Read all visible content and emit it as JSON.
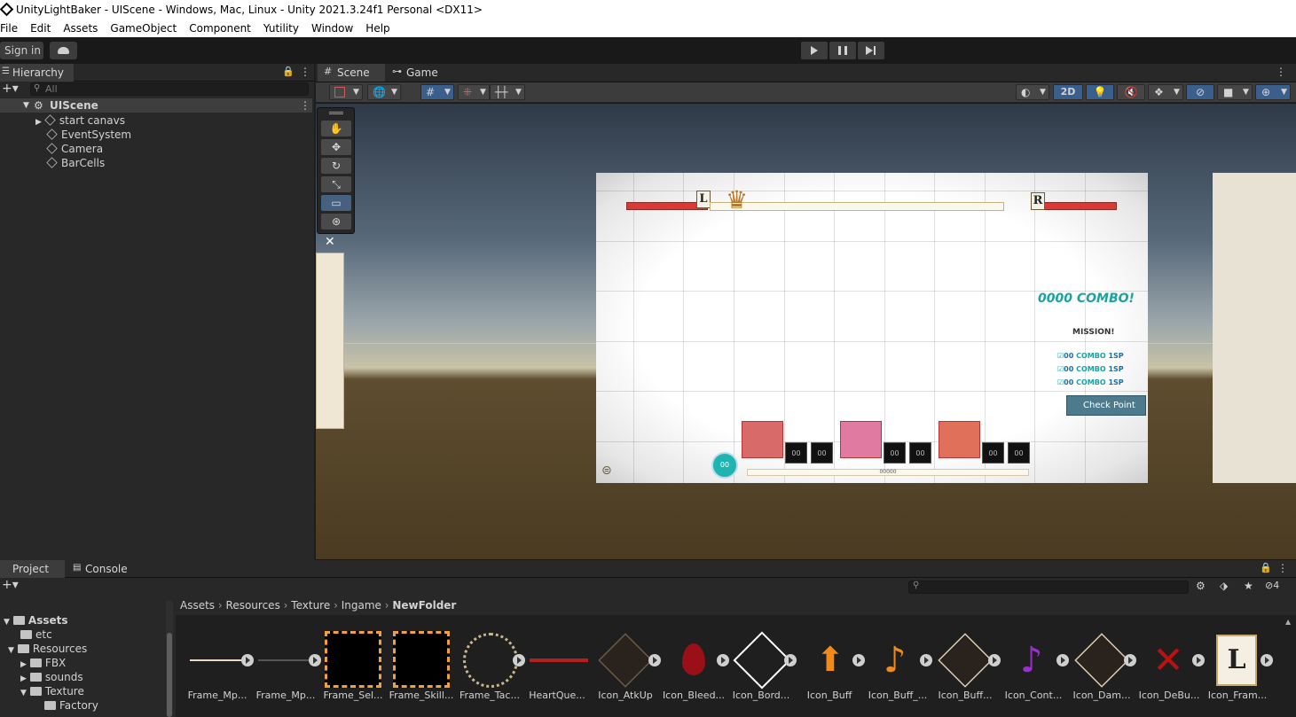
{
  "window": {
    "title": "UnityLightBaker - UIScene - Windows, Mac, Linux - Unity 2021.3.24f1 Personal <DX11>"
  },
  "menu": [
    "File",
    "Edit",
    "Assets",
    "GameObject",
    "Component",
    "Yutility",
    "Window",
    "Help"
  ],
  "toolbar": {
    "sign_in": "Sign in"
  },
  "hierarchy": {
    "tab": "Hierarchy",
    "search_placeholder": "All",
    "scene": "UIScene",
    "items": [
      "start canavs",
      "EventSystem",
      "Camera",
      "BarCells"
    ]
  },
  "scene_view": {
    "tabs": [
      "Scene",
      "Game"
    ],
    "mode_2d": "2D",
    "tools": [
      "hand",
      "move",
      "rotate",
      "scale",
      "rect",
      "transform"
    ]
  },
  "game_ui": {
    "left_marker": "L",
    "right_marker": "R",
    "combo": "0000 COMBO!",
    "mission": "MISSION!",
    "mission_rows": [
      {
        "count": "00",
        "word": "COMBO",
        "sp": "1SP"
      },
      {
        "count": "00",
        "word": "COMBO",
        "sp": "1SP"
      },
      {
        "count": "00",
        "word": "COMBO",
        "sp": "1SP"
      }
    ],
    "checkpoint": "Check Point",
    "progress": "00000",
    "char_counter": "00",
    "dice_values": [
      "00",
      "00",
      "00",
      "00",
      "00",
      "00"
    ]
  },
  "project": {
    "tabs": [
      "Project",
      "Console"
    ],
    "badge": "4",
    "breadcrumb": [
      "Assets",
      "Resources",
      "Texture",
      "Ingame",
      "NewFolder"
    ],
    "tree": [
      {
        "label": "Assets",
        "level": 0,
        "bold": true
      },
      {
        "label": "etc",
        "level": 1
      },
      {
        "label": "Resources",
        "level": 1
      },
      {
        "label": "FBX",
        "level": 2
      },
      {
        "label": "sounds",
        "level": 2
      },
      {
        "label": "Texture",
        "level": 2
      },
      {
        "label": "Factory",
        "level": 3
      }
    ],
    "assets": [
      "Frame_Mp...",
      "Frame_Mp...",
      "Frame_Sel...",
      "Frame_Skill...",
      "Frame_Tac...",
      "HeartQue...",
      "Icon_AtkUp",
      "Icon_Bleed...",
      "Icon_Bord...",
      "Icon_Buff",
      "Icon_Buff_...",
      "Icon_Buff...",
      "Icon_Cont...",
      "Icon_Dam...",
      "Icon_DeBu...",
      "Icon_Fram..."
    ],
    "asset_letter": "L"
  },
  "colors": {
    "accent": "#3a5f8c",
    "red": "#d93a36",
    "teal": "#1aa3a0"
  }
}
